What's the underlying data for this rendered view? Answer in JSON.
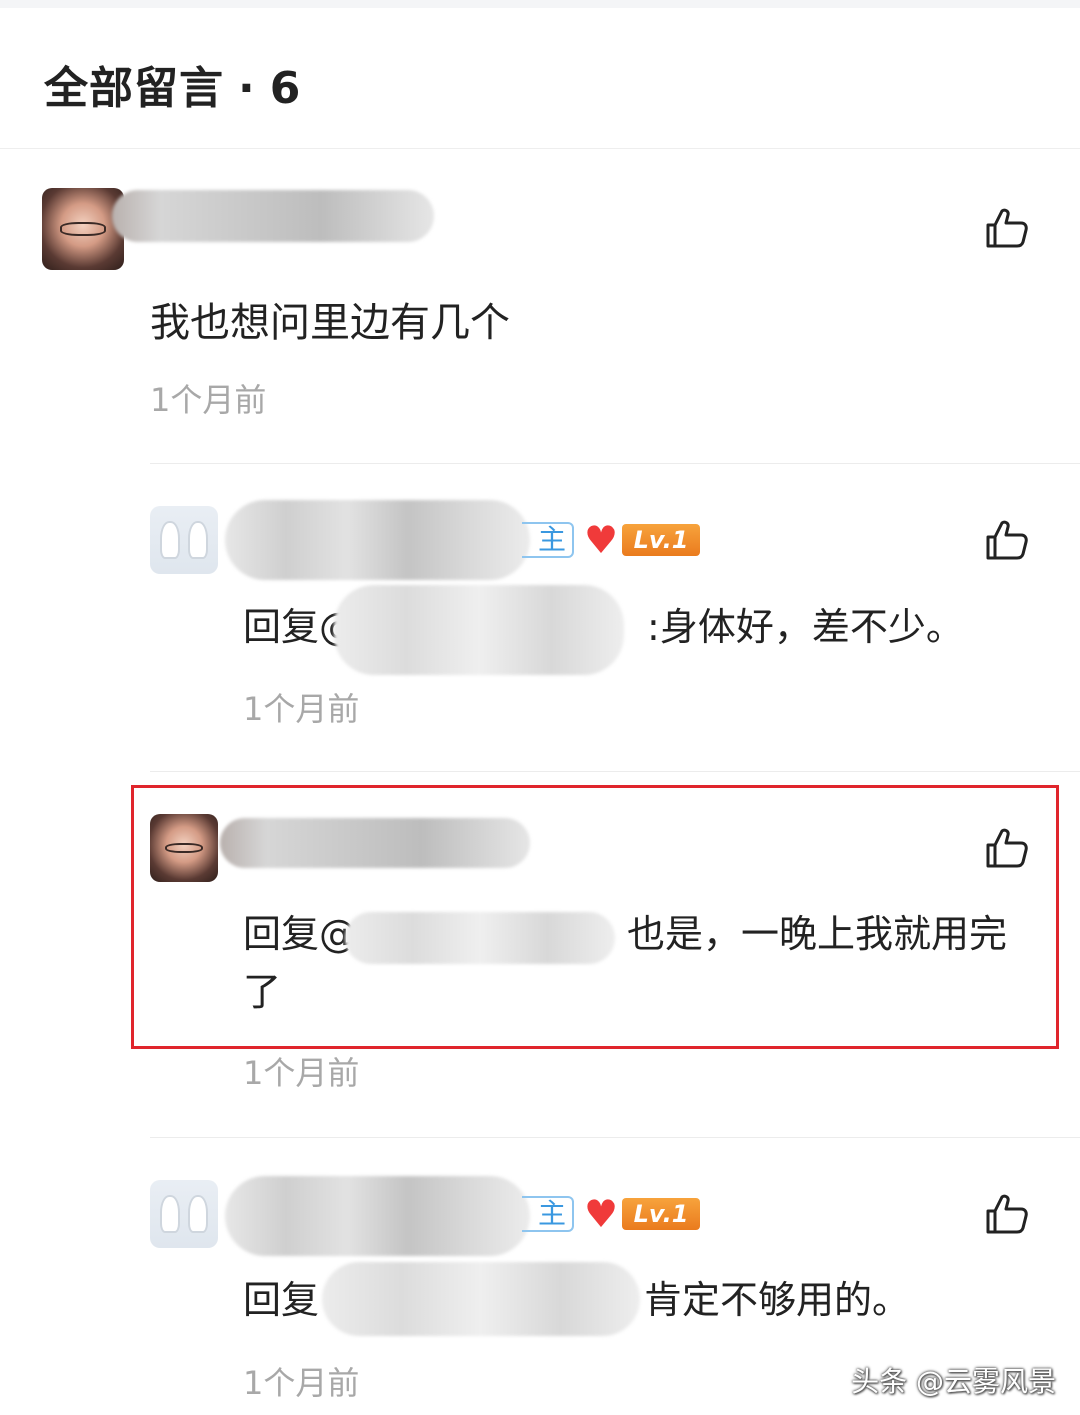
{
  "header": {
    "title": "全部留言",
    "separator": "·",
    "count": "6"
  },
  "comments": [
    {
      "avatar_icon": "profile-photo",
      "text": "我也想问里边有几个",
      "time": "1个月前"
    },
    {
      "avatar_icon": "profile-photo",
      "owner_badge": "主人",
      "level_badge": "Lv.1",
      "reply_prefix": "回复@",
      "reply_text": ":身体好，差不少。",
      "time": "1个月前"
    },
    {
      "avatar_icon": "profile-photo",
      "reply_prefix": "回复@",
      "reply_text_line1": "也是，一晚上我就用完",
      "reply_text_line2": "了",
      "time": "1个月前"
    },
    {
      "avatar_icon": "profile-photo",
      "owner_badge": "主人",
      "level_badge": "Lv.1",
      "reply_prefix": "回复",
      "reply_text": "肯定不够用的。",
      "time": "1个月前"
    }
  ],
  "watermark": "头条 @云雾风景",
  "colors": {
    "highlight": "#e0252c",
    "level_badge": "#ea7b1e",
    "owner_badge": "#3a98e0",
    "heart": "#f03a3a"
  }
}
